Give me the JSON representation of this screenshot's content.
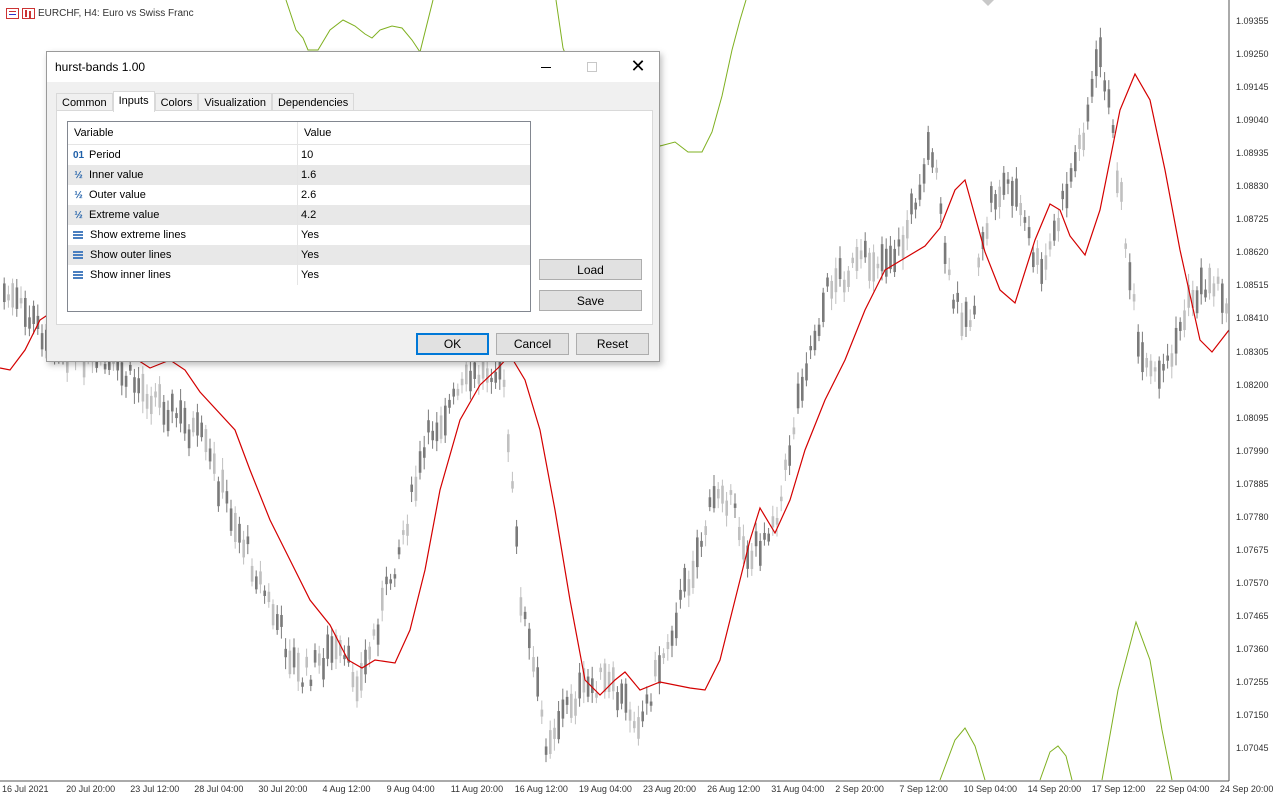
{
  "chart": {
    "symbol_title": "EURCHF, H4:  Euro vs Swiss Franc",
    "price_labels": [
      "1.09355",
      "1.09250",
      "1.09145",
      "1.09040",
      "1.08935",
      "1.08830",
      "1.08725",
      "1.08620",
      "1.08515",
      "1.08410",
      "1.08305",
      "1.08200",
      "1.08095",
      "1.07990",
      "1.07885",
      "1.07780",
      "1.07675",
      "1.07570",
      "1.07465",
      "1.07360",
      "1.07255",
      "1.07150",
      "1.07045"
    ],
    "date_labels": [
      "16 Jul 2021",
      "20 Jul 20:00",
      "23 Jul 12:00",
      "28 Jul 04:00",
      "30 Jul 20:00",
      "4 Aug 12:00",
      "9 Aug 04:00",
      "11 Aug 20:00",
      "16 Aug 12:00",
      "19 Aug 04:00",
      "23 Aug 20:00",
      "26 Aug 12:00",
      "31 Aug 04:00",
      "2 Sep 20:00",
      "7 Sep 12:00",
      "10 Sep 04:00",
      "14 Sep 20:00",
      "17 Sep 12:00",
      "22 Sep 04:00",
      "24 Sep 20:00"
    ],
    "colors": {
      "bull": "#c0c0c0",
      "bear": "#7a7a7a",
      "mid_band": "#d40000",
      "outer_band": "#7fb020"
    }
  },
  "dialog": {
    "title": "hurst-bands 1.00",
    "tabs": [
      "Common",
      "Inputs",
      "Colors",
      "Visualization",
      "Dependencies"
    ],
    "active_tab": "Inputs",
    "table": {
      "headers": [
        "Variable",
        "Value"
      ],
      "rows": [
        {
          "icon": "integer-icon",
          "glyph": "01",
          "name": "Period",
          "value": "10"
        },
        {
          "icon": "double-icon",
          "glyph": "½",
          "name": "Inner value",
          "value": "1.6"
        },
        {
          "icon": "double-icon",
          "glyph": "½",
          "name": "Outer value",
          "value": "2.6"
        },
        {
          "icon": "double-icon",
          "glyph": "½",
          "name": "Extreme value",
          "value": "4.2"
        },
        {
          "icon": "enum-icon",
          "glyph": "",
          "name": "Show extreme lines",
          "value": "Yes"
        },
        {
          "icon": "enum-icon",
          "glyph": "",
          "name": "Show outer lines",
          "value": "Yes"
        },
        {
          "icon": "enum-icon",
          "glyph": "",
          "name": "Show inner lines",
          "value": "Yes"
        }
      ]
    },
    "side_buttons": {
      "load": "Load",
      "save": "Save"
    },
    "buttons": {
      "ok": "OK",
      "cancel": "Cancel",
      "reset": "Reset"
    }
  }
}
